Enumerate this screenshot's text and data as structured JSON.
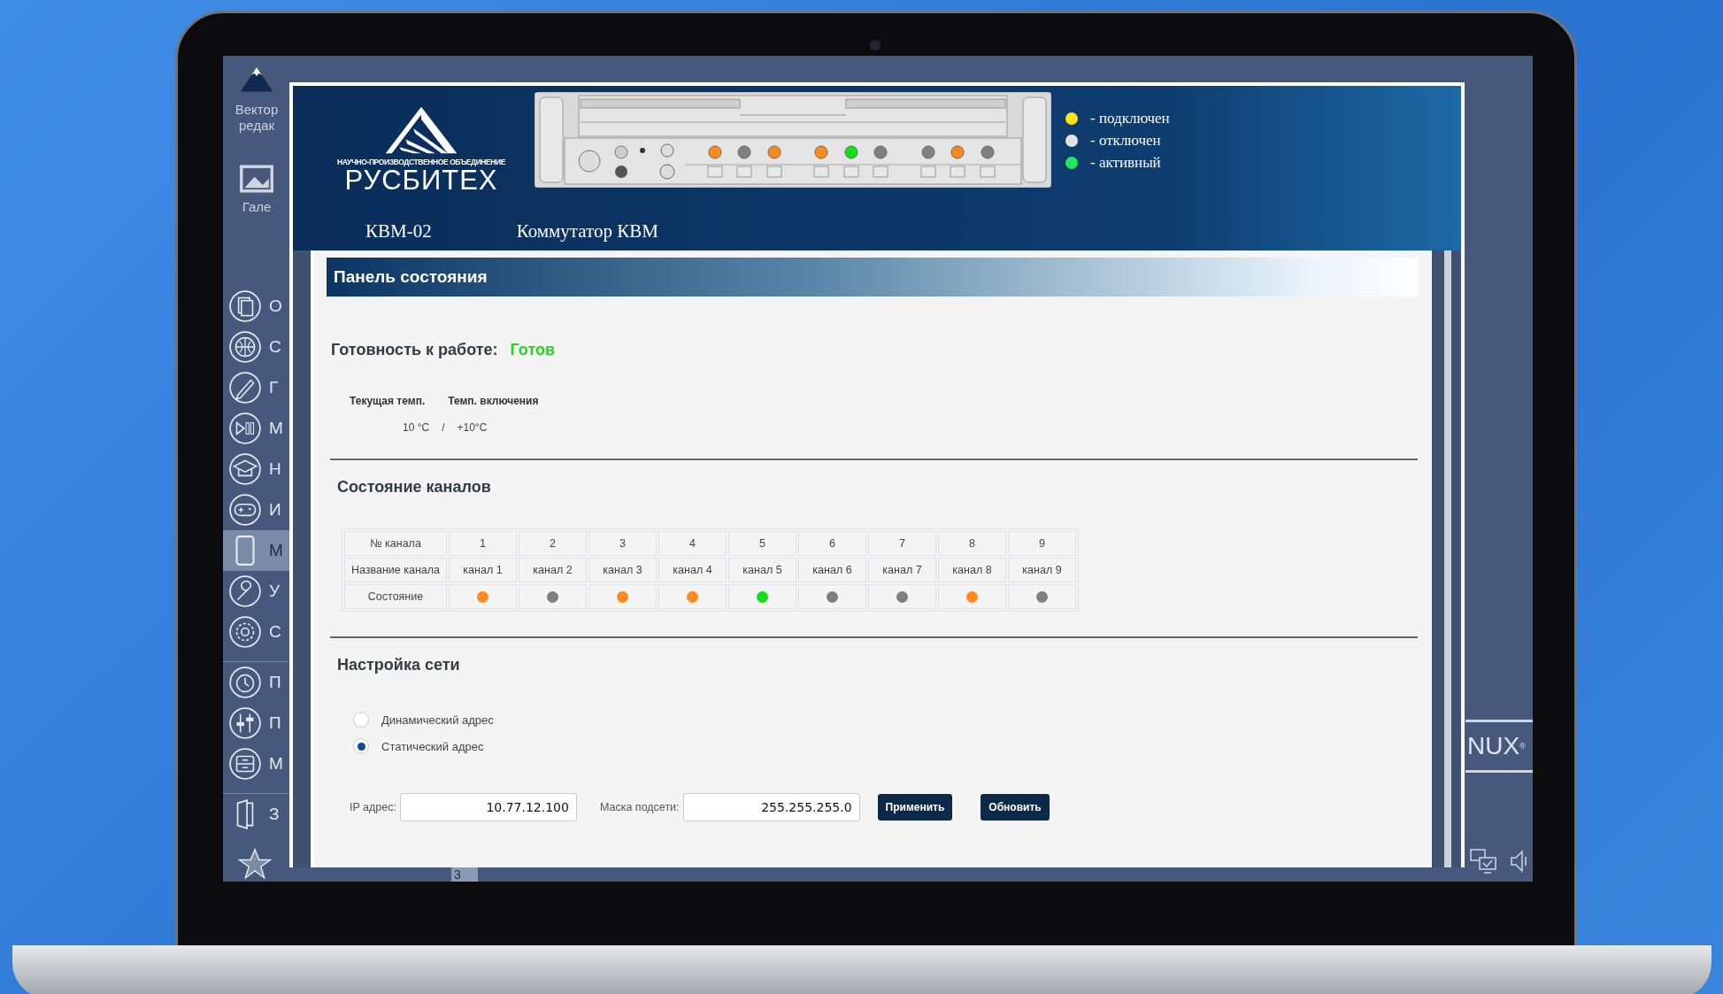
{
  "desktop": {
    "icons": [
      {
        "lines": [
          "Вектор",
          "редак"
        ]
      },
      {
        "lines": [
          "Гале"
        ]
      }
    ],
    "brand": "NUX$^{®}$",
    "taskbar": {
      "workspace": "3"
    }
  },
  "sidebar": {
    "items": [
      {
        "label": "О",
        "selected": false
      },
      {
        "label": "С",
        "selected": false
      },
      {
        "label": "Г",
        "selected": false
      },
      {
        "label": "М",
        "selected": false
      },
      {
        "label": "Н",
        "selected": false
      },
      {
        "label": "И",
        "selected": false
      },
      {
        "label": "М",
        "selected": true
      },
      {
        "label": "У",
        "selected": false
      },
      {
        "label": "С",
        "selected": false
      },
      {
        "label": "П",
        "selected": false
      },
      {
        "label": "П",
        "selected": false
      },
      {
        "label": "М",
        "selected": false
      },
      {
        "label": "З",
        "selected": false
      }
    ]
  },
  "header": {
    "logo": {
      "tagline": "НАУЧНО-ПРОИЗВОДСТВЕННОЕ ОБЪЕДИНЕНИЕ",
      "name": "РУСБИТЕХ"
    },
    "legend": [
      {
        "label": "- подключен",
        "color": "#ffe21a"
      },
      {
        "label": "- отключен",
        "color": "#e2e2e2"
      },
      {
        "label": "- активный",
        "color": "#1fe85a"
      }
    ],
    "tabs": [
      {
        "label": "КВМ-02"
      },
      {
        "label": "Коммутатор КВМ"
      }
    ]
  },
  "panel": {
    "title": "Панель состояния",
    "readiness": {
      "label": "Готовность к работе:",
      "value": "Готов"
    },
    "temperature": {
      "headers": [
        "Текущая темп.",
        "Темп. включения"
      ],
      "current": "10 °C",
      "separator": "/",
      "startup": "+10°C"
    },
    "channels": {
      "title": "Состояние каналов",
      "row_headers": [
        "№ канала",
        "Название канала",
        "Состояние"
      ],
      "items": [
        {
          "number": "1",
          "name": "канал 1",
          "color": "#ff8a1c"
        },
        {
          "number": "2",
          "name": "канал 2",
          "color": "#808080"
        },
        {
          "number": "3",
          "name": "канал 3",
          "color": "#ff8a1c"
        },
        {
          "number": "4",
          "name": "канал 4",
          "color": "#ff8a1c"
        },
        {
          "number": "5",
          "name": "канал 5",
          "color": "#12e012"
        },
        {
          "number": "6",
          "name": "канал 6",
          "color": "#808080"
        },
        {
          "number": "7",
          "name": "канал 7",
          "color": "#808080"
        },
        {
          "number": "8",
          "name": "канал 8",
          "color": "#ff8a1c"
        },
        {
          "number": "9",
          "name": "канал 9",
          "color": "#808080"
        }
      ]
    },
    "network": {
      "title": "Настройка сети",
      "modes": [
        {
          "label": "Динамический адрес",
          "selected": false
        },
        {
          "label": "Статический адрес",
          "selected": true
        }
      ],
      "ip": {
        "label": "IP адрес:",
        "value": "10.77.12.100"
      },
      "mask": {
        "label": "Маска подсети:",
        "value": "255.255.255.0"
      },
      "buttons": [
        "Применить",
        "Обновить"
      ]
    }
  }
}
